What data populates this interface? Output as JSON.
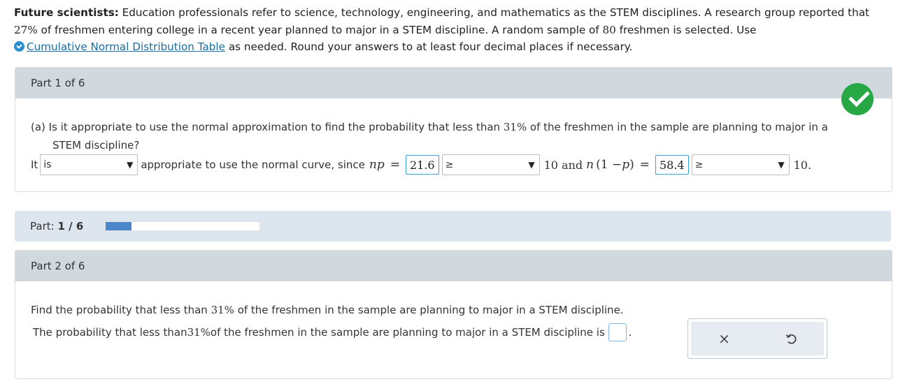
{
  "intro": {
    "bold": "Future scientists:",
    "text1": " Education professionals refer to science, technology, engineering, and mathematics as the STEM disciplines. A research group reported that",
    "pct": "27%",
    "text2": " of freshmen entering college in a recent year planned to major in a STEM discipline. A random sample of ",
    "n": "80",
    "text3": " freshmen is selected. Use",
    "link": "Cumulative Normal Distribution Table",
    "text4": " as needed. Round your answers to at least four decimal places if necessary."
  },
  "part1": {
    "header": "Part 1 of 6",
    "q_prefix": "(a) Is it appropriate to use the normal approximation to find the probability that less than ",
    "q_pct": "31%",
    "q_suffix": " of the freshmen in the sample are planning to major in a",
    "q_line2": "STEM discipline?",
    "it": "It",
    "is_value": "is",
    "mid_text": "appropriate to use the normal curve, since",
    "np_label": "np",
    "equals": "=",
    "np_value": "21.6",
    "ge1": "≥",
    "ten_and": "10 and",
    "nq_n": "n",
    "nq_paren": "(1 − ",
    "nq_p": "p",
    "nq_close": ")",
    "nq_value": "58.4",
    "ge2": "≥",
    "end": "10."
  },
  "progress": {
    "label": "Part:",
    "value": "1 / 6",
    "fraction": 0.1667
  },
  "part2": {
    "header": "Part 2 of 6",
    "q1_prefix": "Find the probability that less than ",
    "pct": "31%",
    "q1_suffix": " of the freshmen in the sample are planning to major in a STEM discipline.",
    "q2_prefix": "The probability that less than ",
    "q2_suffix": " of the freshmen in the sample are planning to major in a STEM discipline is",
    "period": "."
  },
  "tools": {
    "clear_icon": "×",
    "undo_icon": "undo-icon"
  },
  "colors": {
    "header_gray": "#d1d9de",
    "progress_bg": "#dde6ef",
    "progress_fill": "#4a86c8",
    "check_green": "#27a844",
    "link_blue": "#1a6d9e"
  }
}
